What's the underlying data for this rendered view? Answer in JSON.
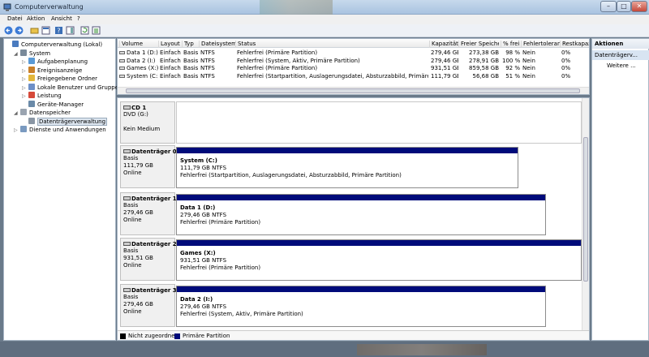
{
  "window": {
    "title": "Computerverwaltung"
  },
  "menu": [
    "Datei",
    "Aktion",
    "Ansicht",
    "?"
  ],
  "tree": [
    {
      "label": "Computerverwaltung (Lokal)",
      "level": 0,
      "icon": "computer-icon",
      "twisty": ""
    },
    {
      "label": "System",
      "level": 1,
      "icon": "system-tools-icon",
      "twisty": "◢"
    },
    {
      "label": "Aufgabenplanung",
      "level": 2,
      "icon": "clock-icon",
      "twisty": "▷"
    },
    {
      "label": "Ereignisanzeige",
      "level": 2,
      "icon": "event-viewer-icon",
      "twisty": "▷"
    },
    {
      "label": "Freigegebene Ordner",
      "level": 2,
      "icon": "shared-folder-icon",
      "twisty": "▷"
    },
    {
      "label": "Lokale Benutzer und Gruppen",
      "level": 2,
      "icon": "users-icon",
      "twisty": "▷"
    },
    {
      "label": "Leistung",
      "level": 2,
      "icon": "performance-icon",
      "twisty": "▷"
    },
    {
      "label": "Geräte-Manager",
      "level": 2,
      "icon": "device-manager-icon",
      "twisty": ""
    },
    {
      "label": "Datenspeicher",
      "level": 1,
      "icon": "storage-icon",
      "twisty": "◢"
    },
    {
      "label": "Datenträgerverwaltung",
      "level": 2,
      "icon": "disk-management-icon",
      "twisty": "",
      "selected": true
    },
    {
      "label": "Dienste und Anwendungen",
      "level": 1,
      "icon": "services-icon",
      "twisty": "▷"
    }
  ],
  "volume_table": {
    "columns": [
      "Volume",
      "Layout",
      "Typ",
      "Dateisystem",
      "Status",
      "Kapazität",
      "Freier Speicher",
      "% frei",
      "Fehlertoleranz",
      "Restkapazitä"
    ],
    "rows": [
      [
        "Data 1 (D:)",
        "Einfach",
        "Basis",
        "NTFS",
        "Fehlerfrei (Primäre Partition)",
        "279,46 GB",
        "273,38 GB",
        "98 %",
        "Nein",
        "0%"
      ],
      [
        "Data 2 (I:)",
        "Einfach",
        "Basis",
        "NTFS",
        "Fehlerfrei (System, Aktiv, Primäre Partition)",
        "279,46 GB",
        "278,91 GB",
        "100 %",
        "Nein",
        "0%"
      ],
      [
        "Games (X:)",
        "Einfach",
        "Basis",
        "NTFS",
        "Fehlerfrei (Primäre Partition)",
        "931,51 GB",
        "859,58 GB",
        "92 %",
        "Nein",
        "0%"
      ],
      [
        "System (C:)",
        "Einfach",
        "Basis",
        "NTFS",
        "Fehlerfrei (Startpartition, Auslagerungsdatei, Absturzabbild, Primäre Partition)",
        "111,79 GB",
        "56,68 GB",
        "51 %",
        "Nein",
        "0%"
      ]
    ]
  },
  "disks": [
    {
      "name": "CD 1",
      "lines": [
        "DVD (G:)",
        "",
        "Kein Medium"
      ],
      "partition": null
    },
    {
      "name": "Datenträger 0",
      "lines": [
        "Basis",
        "111,79 GB",
        "Online"
      ],
      "partition": {
        "name": "System  (C:)",
        "size": "111,79 GB NTFS",
        "status": "Fehlerfrei (Startpartition, Auslagerungsdatei, Absturzabbild, Primäre Partition)"
      }
    },
    {
      "name": "Datenträger 1",
      "lines": [
        "Basis",
        "279,46 GB",
        "Online"
      ],
      "partition": {
        "name": "Data 1  (D:)",
        "size": "279,46 GB NTFS",
        "status": "Fehlerfrei (Primäre Partition)"
      }
    },
    {
      "name": "Datenträger 2",
      "lines": [
        "Basis",
        "931,51 GB",
        "Online"
      ],
      "partition": {
        "name": "Games  (X:)",
        "size": "931,51 GB NTFS",
        "status": "Fehlerfrei (Primäre Partition)"
      }
    },
    {
      "name": "Datenträger 3",
      "lines": [
        "Basis",
        "279,46 GB",
        "Online"
      ],
      "partition": {
        "name": "Data 2  (I:)",
        "size": "279,46 GB NTFS",
        "status": "Fehlerfrei (System, Aktiv, Primäre Partition)"
      }
    }
  ],
  "legend": [
    {
      "label": "Nicht zugeordnet",
      "color": "#000000"
    },
    {
      "label": "Primäre Partition",
      "color": "#000b7a"
    }
  ],
  "actions": {
    "header": "Aktionen",
    "selected": "Datenträgerv...",
    "more": "Weitere ..."
  },
  "colors": {
    "partition_bar": "#000b7a",
    "selection": "#d8e4f2"
  }
}
